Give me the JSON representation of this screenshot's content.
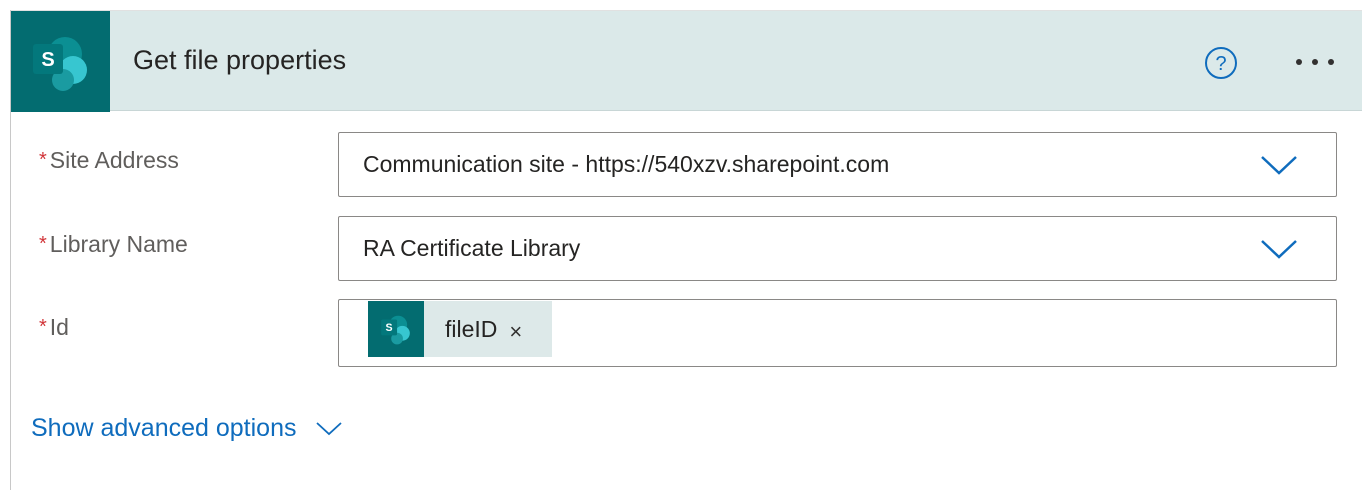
{
  "action": {
    "title": "Get file properties",
    "connector_icon": "sharepoint-icon",
    "brand_color": "#036c70",
    "header_color": "#dbe9e9",
    "help_icon": "help-circle-icon",
    "more_icon": "more-dots-icon"
  },
  "fields": {
    "site_address": {
      "label": "Site Address",
      "required_marker": "*",
      "value": "Communication site - https://540xzv.sharepoint.com"
    },
    "library_name": {
      "label": "Library Name",
      "required_marker": "*",
      "value": "RA Certificate Library"
    },
    "id": {
      "label": "Id",
      "required_marker": "*",
      "token_label": "fileID",
      "token_remove": "×"
    }
  },
  "advanced": {
    "label": "Show advanced options",
    "link_color": "#0f6cbd"
  }
}
